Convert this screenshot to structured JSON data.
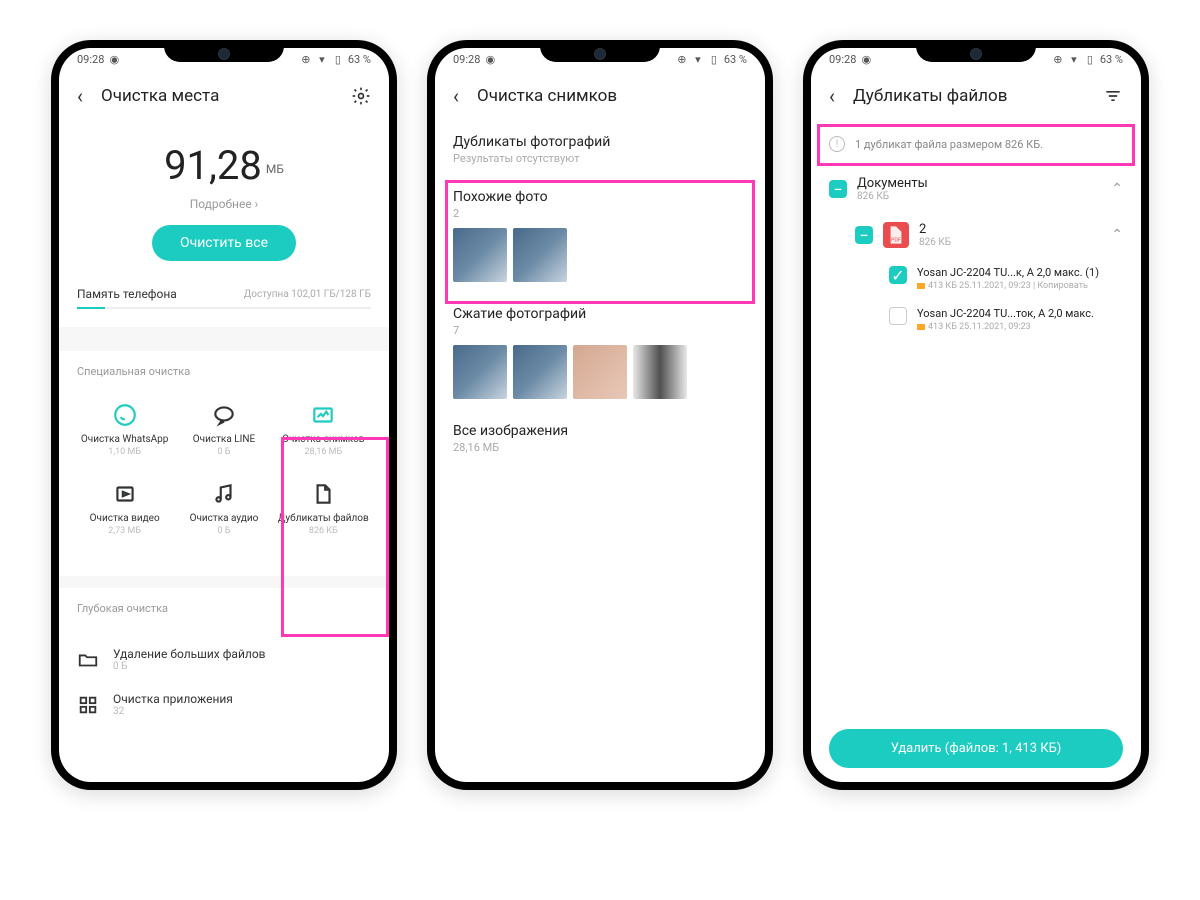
{
  "status": {
    "time": "09:28",
    "bat": "63 %"
  },
  "p1": {
    "title": "Очистка места",
    "big": "91,28",
    "unit": "МБ",
    "more": "Подробнее ›",
    "clear": "Очистить все",
    "mem_l": "Память телефона",
    "mem_r": "Доступна 102,01 ГБ/128 ГБ",
    "sec": "Специальная очистка",
    "tiles": [
      {
        "l": "Очистка WhatsApp",
        "v": "1,10 МБ"
      },
      {
        "l": "Очистка LINE",
        "v": "0 Б"
      },
      {
        "l": "Очистка снимков",
        "v": "28,16 МБ"
      },
      {
        "l": "Очистка видео",
        "v": "2,73 МБ"
      },
      {
        "l": "Очистка аудио",
        "v": "0 Б"
      },
      {
        "l": "Дубликаты файлов",
        "v": "826 КБ"
      }
    ],
    "deep": "Глубокая очистка",
    "d1": "Удаление больших файлов",
    "d1v": "0 Б",
    "d2": "Очистка приложения",
    "d2v": "32"
  },
  "p2": {
    "title": "Очистка снимков",
    "s1": "Дубликаты фотографий",
    "s1s": "Результаты отсутствуют",
    "s2": "Похожие фото",
    "s2s": "2",
    "s3": "Сжатие фотографий",
    "s3s": "7",
    "s4": "Все изображения",
    "s4s": "28,16 МБ"
  },
  "p3": {
    "title": "Дубликаты файлов",
    "info": "1 дубликат файла размером 826 КБ.",
    "g1": "Документы",
    "g1v": "826 КБ",
    "g2": "2",
    "g2v": "826 КБ",
    "f1": "Yosan JC-2204 TU...к, А 2,0 макс. (1)",
    "f1m": "413 КБ 25.11.2021, 09:23  |  Копировать",
    "f2": "Yosan JC-2204 TU...ток, А 2,0 макс.",
    "f2m": "413 КБ 25.11.2021, 09:23",
    "del": "Удалить (файлов: 1, 413 КБ)"
  }
}
